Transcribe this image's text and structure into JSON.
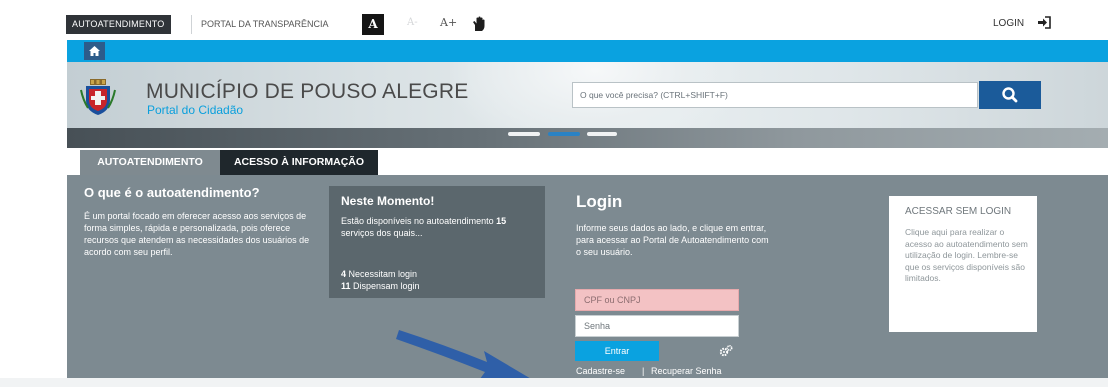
{
  "topbar": {
    "autoatendimento": "AUTOATENDIMENTO",
    "portal_transparencia": "PORTAL DA TRANSPARÊNCIA",
    "font_normal": "A",
    "font_small": "A-",
    "font_large": "A+",
    "login": "LOGIN",
    "login_icon": "sign-in-icon",
    "accessibility_icon": "hand-sign-icon"
  },
  "nav": {
    "home_icon": "home-icon"
  },
  "header": {
    "title": "MUNICÍPIO DE POUSO ALEGRE",
    "subtitle": "Portal do Cidadão",
    "crest_icon": "municipal-crest-icon",
    "search_placeholder": "O que você precisa? (CTRL+SHIFT+F)",
    "search_icon": "search-icon"
  },
  "tabs": [
    {
      "label": "AUTOATENDIMENTO",
      "active": true
    },
    {
      "label": "ACESSO À INFORMAÇÃO",
      "active": false
    }
  ],
  "info": {
    "title": "O que é o autoatendimento?",
    "body": "É um portal focado em oferecer acesso aos serviços de forma simples, rápida e personalizada, pois oferece recursos que atendem as necessidades dos usuários de acordo com seu perfil."
  },
  "now": {
    "title": "Neste Momento!",
    "body_prefix": "Estão disponíveis no autoatendimento ",
    "count": "15",
    "body_suffix": " serviços dos quais...",
    "line1_count": "4",
    "line1_text": " Necessitam login",
    "line2_count": "11",
    "line2_text": " Dispensam login"
  },
  "login": {
    "title": "Login",
    "description": "Informe seus dados ao lado, e clique em entrar, para acessar ao Portal de Autoatendimento com o seu usuário.",
    "cpf_placeholder": "CPF ou CNPJ",
    "password_placeholder": "Senha",
    "enter_label": "Entrar",
    "options_icon": "gears-icon",
    "register_label": "Cadastre-se",
    "separator": "|",
    "recover_label": "Recuperar Senha"
  },
  "nologin": {
    "title": "ACESSAR SEM LOGIN",
    "body": "Clique aqui para realizar o acesso ao autoatendimento sem utilização de login. Lembre-se que os serviços disponíveis são limitados."
  },
  "colors": {
    "brand_blue": "#0aa2e0",
    "dark_navy": "#1b5b9a",
    "panel_gray": "#7d8a91",
    "annotation_arrow": "#2f5fa8"
  }
}
